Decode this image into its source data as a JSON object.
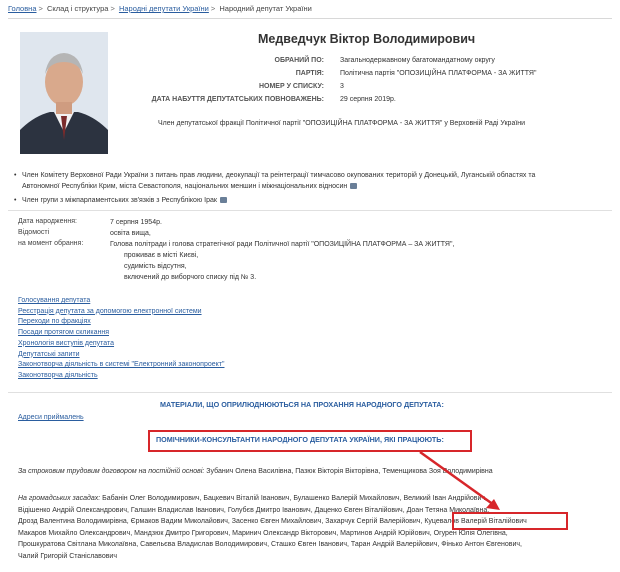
{
  "breadcrumbs": [
    "Головна",
    "Склад і структура",
    "Народні депутати України",
    "Народний депутат України"
  ],
  "deputy": {
    "name": "Медведчук Віктор Володимирович",
    "fields": [
      {
        "label": "ОБРАНИЙ ПО:",
        "value": "Загальнодержавному багатомандатному округу"
      },
      {
        "label": "ПАРТІЯ:",
        "value": "Політична партія \"ОПОЗИЦІЙНА ПЛАТФОРМА - ЗА ЖИТТЯ\""
      },
      {
        "label": "НОМЕР У СПИСКУ:",
        "value": "3"
      },
      {
        "label": "ДАТА НАБУТТЯ ДЕПУТАТСЬКИХ ПОВНОВАЖЕНЬ:",
        "value": "29 серпня 2019р."
      }
    ],
    "membership": "Член депутатської фракції Політичної партії \"ОПОЗИЦІЙНА ПЛАТФОРМА - ЗА ЖИТТЯ\" у Верховній Раді України"
  },
  "committees": [
    {
      "lines": [
        "Член Комітету Верховної Ради України з питань прав людини, деокупації та реінтеграції тимчасово окупованих територій у Донецькій, Луганській областях та",
        "Автономної Республіки Крим, міста Севастополя, національних меншин і міжнаціональних відносин"
      ]
    },
    {
      "lines": [
        "Член групи з міжпарламентських зв'язків з Республікою Ірак"
      ]
    }
  ],
  "bio": [
    {
      "label": "Дата народження:",
      "values": [
        "7 серпня 1954р."
      ]
    },
    {
      "label": "Відомості",
      "values": [
        "освіта вища,"
      ]
    },
    {
      "label": "на момент обрання:",
      "values": [
        "Голова політради і голова стратегічної ради Політичної партії \"ОПОЗИЦІЙНА ПЛАТФОРМА – ЗА ЖИТТЯ\",",
        "проживає в місті Києві,",
        "судимість відсутня,",
        "включений до виборчого списку під № 3."
      ]
    }
  ],
  "links": [
    "Голосування депутата",
    "Реєстрація депутата за допомогою електронної системи",
    "Переходи по фракціях",
    "Посади протягом скликання",
    "Хронологія виступів депутата",
    "Депутатські запити",
    "Законотворча діяльність в системі \"Електронний законопроект\"",
    "Законотворча діяльність"
  ],
  "reception_link": "Адреси приймалень",
  "materials_title": "МАТЕРІАЛИ, ЩО ОПРИЛЮДНЮЮТЬСЯ НА ПРОХАННЯ НАРОДНОГО ДЕПУТАТА:",
  "assistants_title": "ПОМІЧНИКИ-КОНСУЛЬТАНТИ НАРОДНОГО ДЕПУТАТА УКРАЇНИ, ЯКІ ПРАЦЮЮТЬ:",
  "contract": {
    "label": "За строковим трудовим договором на постійній основі:",
    "names": "Зубанич Олена Василівна, Пазюк Вікторія Вікторівна, Теменщикова Зоя Володимирівна"
  },
  "volunteer": {
    "label": "На громадських засадах:",
    "line1": "Бабанін Олег Володимирович, Бацкевич Віталій Іванович, Булашенко Валерій Михайлович, Великий Іван Андрійович,",
    "line2": "Відішенко Андрій Олександрович, Галшин Владислав Іванович, Голубєв Дмитро Іванович, Даценко Євген Віталійович, Доан Тетяна Миколаївна,",
    "line3_before": "Дрозд Валентина Володимирівна, Єрмаков Вадим Миколайович, Засенко Євген Михайлович, Захарчук Сергій Валерійович,",
    "highlighted": "Куцевалов Валерій Віталійович",
    "line4": "Макаров Михайло Олександрович, Мандзюк Дмитро Григорович, Маринич Олександр Вікторович, Мартинов Андрій Юрійович, Огурен Юлія Олегівна,",
    "line5": "Прошкуратова Світлана Миколаївна, Савельєва Владислав Володимирович, Сташко Євген Іванович, Таран Андрій Валерійович, Фінько Антон Євгенович,",
    "line6": "Чалий Григорій Станіславович"
  },
  "colors": {
    "link": "#2a5d9f",
    "highlight": "#d7262a"
  }
}
